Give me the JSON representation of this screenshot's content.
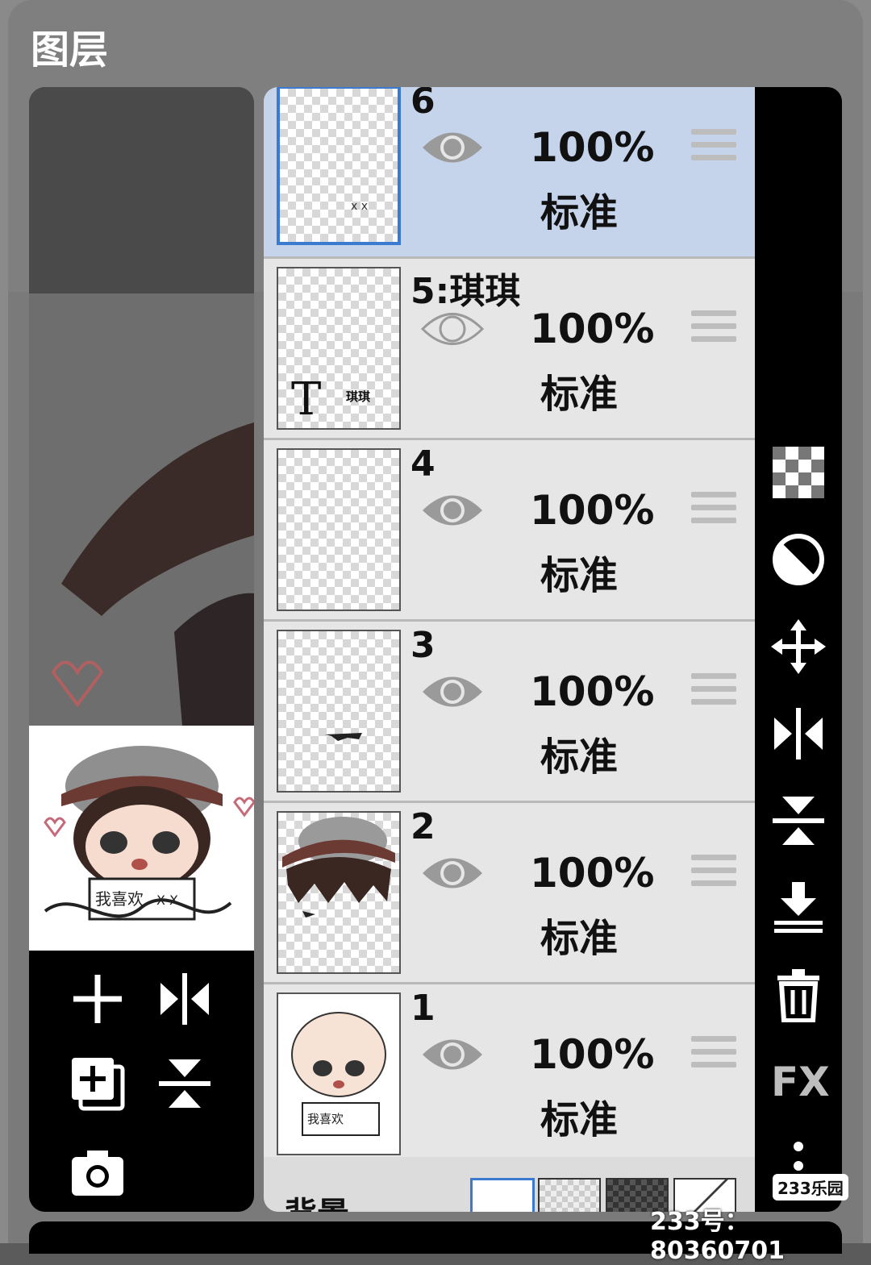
{
  "panel": {
    "title": "图层"
  },
  "layers": [
    {
      "name": "6",
      "opacity": "100%",
      "blend": "标准",
      "visible": true,
      "selected": true
    },
    {
      "name": "5:琪琪",
      "opacity": "100%",
      "blend": "标准",
      "visible": false,
      "selected": false,
      "thumb_text": "琪琪",
      "thumb_glyph": "T"
    },
    {
      "name": "4",
      "opacity": "100%",
      "blend": "标准",
      "visible": true,
      "selected": false
    },
    {
      "name": "3",
      "opacity": "100%",
      "blend": "标准",
      "visible": true,
      "selected": false
    },
    {
      "name": "2",
      "opacity": "100%",
      "blend": "标准",
      "visible": true,
      "selected": false
    },
    {
      "name": "1",
      "opacity": "100%",
      "blend": "标准",
      "visible": true,
      "selected": false,
      "thumb_text": "我喜欢"
    }
  ],
  "preview": {
    "sign_text": "我喜欢",
    "sign_suffix": "X X"
  },
  "background_row": {
    "label": "背景"
  },
  "right_toolbar": {
    "icons": [
      "checker-icon",
      "contrast-icon",
      "move-icon",
      "flip-horizontal-icon",
      "flip-vertical-icon",
      "merge-down-icon",
      "trash-icon",
      "fx-icon",
      "more-icon"
    ],
    "fx_label": "FX"
  },
  "left_toolbar": {
    "icons": [
      "add-layer-icon",
      "flip-horizontal-icon",
      "duplicate-layer-icon",
      "flip-vertical-icon",
      "camera-icon"
    ]
  },
  "watermark": {
    "logo": "233乐园",
    "id_text": "233号：80360701"
  },
  "colors": {
    "selected_row": "#c5d4ea",
    "row": "#e6e6e6",
    "accent": "#3a7ad0",
    "toolbar": "#000000"
  }
}
